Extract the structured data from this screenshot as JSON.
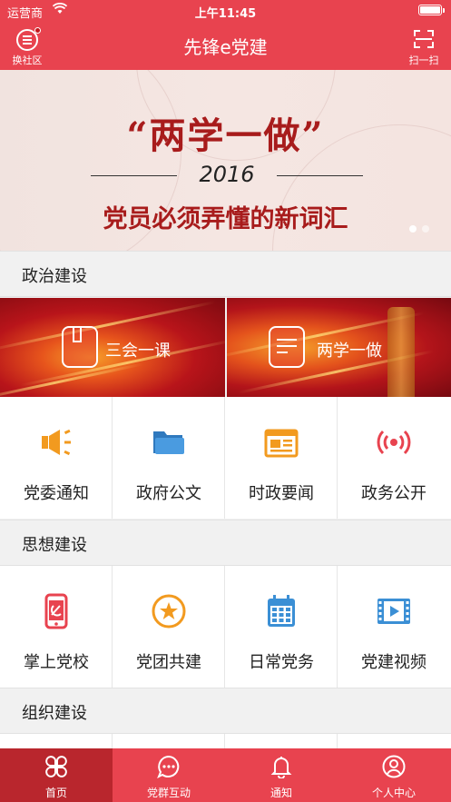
{
  "status": {
    "carrier": "运营商",
    "time": "上午11:45"
  },
  "nav": {
    "left_label": "换社区",
    "title": "先锋e党建",
    "right_label": "扫一扫"
  },
  "banner": {
    "headline": "“两学一做”",
    "year": "2016",
    "subline": "党员必须弄懂的新词汇",
    "page_count": 2,
    "active_page": 1
  },
  "sections": {
    "political": "政治建设",
    "ideological": "思想建设",
    "organizational": "组织建设"
  },
  "tiles": [
    {
      "label": "三会一课",
      "icon": "book-icon"
    },
    {
      "label": "两学一做",
      "icon": "document-edit-icon"
    }
  ],
  "political_grid": [
    {
      "label": "党委通知",
      "icon": "megaphone-icon",
      "color": "#f29a1f"
    },
    {
      "label": "政府公文",
      "icon": "folder-icon",
      "color": "#3b8fd5"
    },
    {
      "label": "时政要闻",
      "icon": "newspaper-icon",
      "color": "#f29a1f"
    },
    {
      "label": "政务公开",
      "icon": "broadcast-icon",
      "color": "#e8434f"
    }
  ],
  "ideological_grid": [
    {
      "label": "掌上党校",
      "icon": "phone-party-icon",
      "color": "#e8434f"
    },
    {
      "label": "党团共建",
      "icon": "star-badge-icon",
      "color": "#f29a1f"
    },
    {
      "label": "日常党务",
      "icon": "calendar-icon",
      "color": "#3b8fd5"
    },
    {
      "label": "党建视频",
      "icon": "video-icon",
      "color": "#3b8fd5"
    }
  ],
  "tabs": [
    {
      "label": "首页",
      "icon": "grid-clover-icon",
      "active": true
    },
    {
      "label": "党群互动",
      "icon": "chat-bubble-icon",
      "active": false
    },
    {
      "label": "通知",
      "icon": "bell-icon",
      "active": false
    },
    {
      "label": "个人中心",
      "icon": "person-icon",
      "active": false
    }
  ],
  "colors": {
    "brand": "#e8434f",
    "tab_active": "#b9262d",
    "orange": "#f29a1f",
    "blue": "#3b8fd5"
  }
}
